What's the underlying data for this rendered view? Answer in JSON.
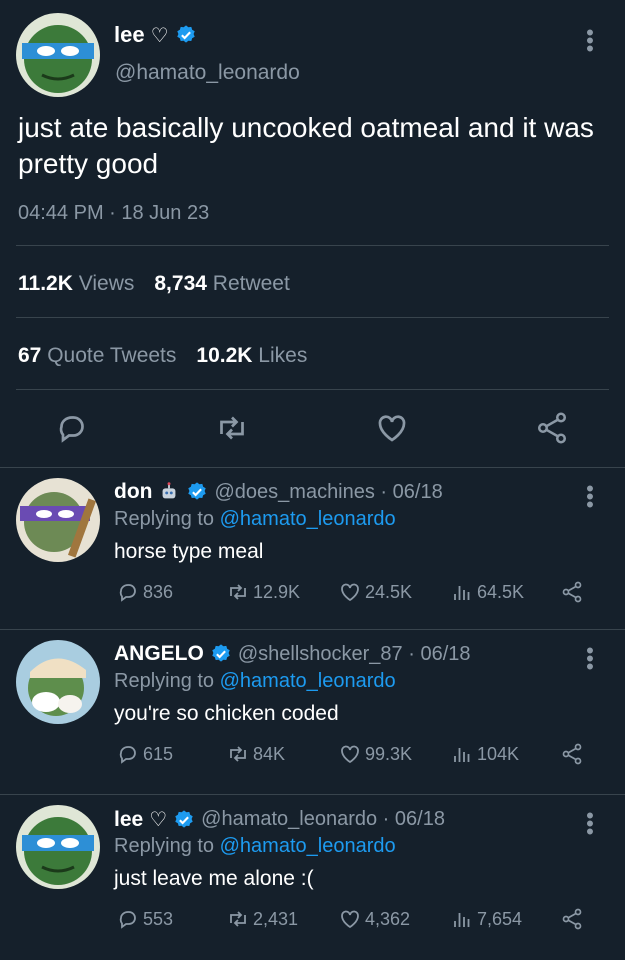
{
  "colors": {
    "background": "#15202b",
    "text": "#ffffff",
    "muted": "#8b98a5",
    "accent": "#1d9bf0",
    "divider": "#38444d"
  },
  "main_tweet": {
    "name": "lee",
    "name_heart": "♡",
    "handle": "@hamato_leonardo",
    "text": "just ate basically uncooked oatmeal and it was pretty good",
    "time": "04:44 PM · 18 Jun 23",
    "views_count": "11.2K",
    "views_label": "Views",
    "retweets_count": "8,734",
    "retweets_label": "Retweet",
    "quotes_count": "67",
    "quotes_label": "Quote Tweets",
    "likes_count": "10.2K",
    "likes_label": "Likes",
    "icons": [
      "reply-icon",
      "retweet-icon",
      "like-icon",
      "share-icon"
    ]
  },
  "replies": [
    {
      "name": "don",
      "name_emoji": "robot-icon",
      "handle_date": "@does_machines · 06/18",
      "replying_prefix": "Replying to",
      "mention": "@hamato_leonardo",
      "text": "horse type meal",
      "replies": "836",
      "retweets": "12.9K",
      "likes": "24.5K",
      "views": "64.5K"
    },
    {
      "name": "ANGELO",
      "handle_date": "@shellshocker_87 · 06/18",
      "replying_prefix": "Replying to",
      "mention": "@hamato_leonardo",
      "text": "you're so chicken coded",
      "replies": "615",
      "retweets": "84K",
      "likes": "99.3K",
      "views": "104K"
    },
    {
      "name": "lee",
      "name_heart": "♡",
      "handle_date": "@hamato_leonardo · 06/18",
      "replying_prefix": "Replying to",
      "mention": "@hamato_leonardo",
      "text": "just leave me alone :(",
      "replies": "553",
      "retweets": "2,431",
      "likes": "4,362",
      "views": "7,654"
    }
  ]
}
